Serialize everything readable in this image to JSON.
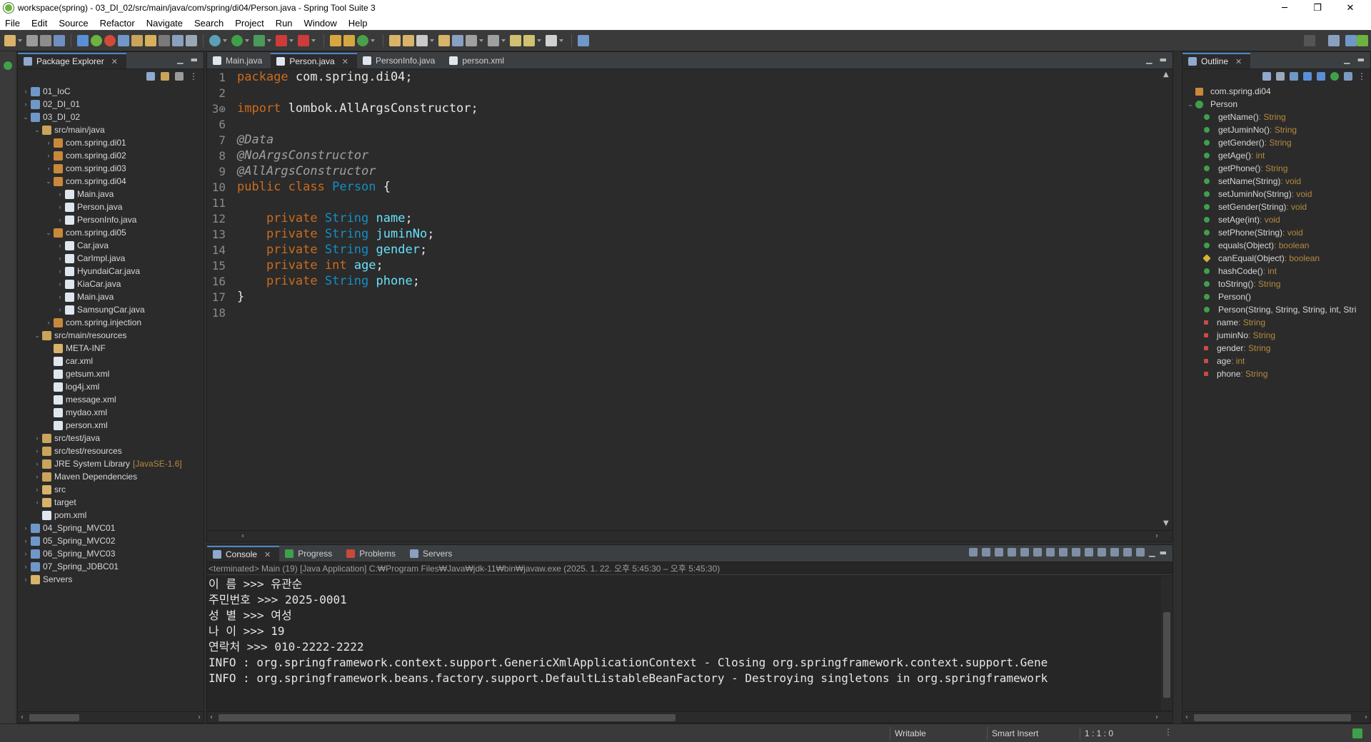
{
  "window": {
    "title": "workspace(spring) - 03_DI_02/src/main/java/com/spring/di04/Person.java - Spring Tool Suite 3",
    "minimize": "─",
    "maximize": "❐",
    "close": "✕"
  },
  "menu": [
    "File",
    "Edit",
    "Source",
    "Refactor",
    "Navigate",
    "Search",
    "Project",
    "Run",
    "Window",
    "Help"
  ],
  "package_explorer": {
    "title": "Package Explorer",
    "close": "✕",
    "tree": [
      {
        "label": "01_IoC",
        "depth": 0,
        "arrow": "›",
        "icon": "project"
      },
      {
        "label": "02_DI_01",
        "depth": 0,
        "arrow": "›",
        "icon": "project"
      },
      {
        "label": "03_DI_02",
        "depth": 0,
        "arrow": "⌄",
        "icon": "project"
      },
      {
        "label": "src/main/java",
        "depth": 1,
        "arrow": "⌄",
        "icon": "srcfolder"
      },
      {
        "label": "com.spring.di01",
        "depth": 2,
        "arrow": "›",
        "icon": "package"
      },
      {
        "label": "com.spring.di02",
        "depth": 2,
        "arrow": "›",
        "icon": "package"
      },
      {
        "label": "com.spring.di03",
        "depth": 2,
        "arrow": "›",
        "icon": "package"
      },
      {
        "label": "com.spring.di04",
        "depth": 2,
        "arrow": "⌄",
        "icon": "package"
      },
      {
        "label": "Main.java",
        "depth": 3,
        "arrow": "›",
        "icon": "java"
      },
      {
        "label": "Person.java",
        "depth": 3,
        "arrow": "›",
        "icon": "java"
      },
      {
        "label": "PersonInfo.java",
        "depth": 3,
        "arrow": "›",
        "icon": "java"
      },
      {
        "label": "com.spring.di05",
        "depth": 2,
        "arrow": "⌄",
        "icon": "package"
      },
      {
        "label": "Car.java",
        "depth": 3,
        "arrow": "›",
        "icon": "java"
      },
      {
        "label": "CarImpl.java",
        "depth": 3,
        "arrow": "›",
        "icon": "java"
      },
      {
        "label": "HyundaiCar.java",
        "depth": 3,
        "arrow": "›",
        "icon": "java"
      },
      {
        "label": "KiaCar.java",
        "depth": 3,
        "arrow": "›",
        "icon": "java"
      },
      {
        "label": "Main.java",
        "depth": 3,
        "arrow": "›",
        "icon": "java"
      },
      {
        "label": "SamsungCar.java",
        "depth": 3,
        "arrow": "›",
        "icon": "java"
      },
      {
        "label": "com.spring.injection",
        "depth": 2,
        "arrow": "›",
        "icon": "package"
      },
      {
        "label": "src/main/resources",
        "depth": 1,
        "arrow": "⌄",
        "icon": "srcfolder"
      },
      {
        "label": "META-INF",
        "depth": 2,
        "arrow": "",
        "icon": "folder"
      },
      {
        "label": "car.xml",
        "depth": 2,
        "arrow": "",
        "icon": "xml"
      },
      {
        "label": "getsum.xml",
        "depth": 2,
        "arrow": "",
        "icon": "xml"
      },
      {
        "label": "log4j.xml",
        "depth": 2,
        "arrow": "",
        "icon": "xml"
      },
      {
        "label": "message.xml",
        "depth": 2,
        "arrow": "",
        "icon": "xml"
      },
      {
        "label": "mydao.xml",
        "depth": 2,
        "arrow": "",
        "icon": "xml"
      },
      {
        "label": "person.xml",
        "depth": 2,
        "arrow": "",
        "icon": "xml"
      },
      {
        "label": "src/test/java",
        "depth": 1,
        "arrow": "›",
        "icon": "srcfolder"
      },
      {
        "label": "src/test/resources",
        "depth": 1,
        "arrow": "›",
        "icon": "srcfolder"
      },
      {
        "label": "JRE System Library",
        "deco": "[JavaSE-1.6]",
        "depth": 1,
        "arrow": "›",
        "icon": "library"
      },
      {
        "label": "Maven Dependencies",
        "depth": 1,
        "arrow": "›",
        "icon": "library"
      },
      {
        "label": "src",
        "depth": 1,
        "arrow": "›",
        "icon": "folder"
      },
      {
        "label": "target",
        "depth": 1,
        "arrow": "›",
        "icon": "folder"
      },
      {
        "label": "pom.xml",
        "depth": 1,
        "arrow": "",
        "icon": "xml"
      },
      {
        "label": "04_Spring_MVC01",
        "depth": 0,
        "arrow": "›",
        "icon": "project"
      },
      {
        "label": "05_Spring_MVC02",
        "depth": 0,
        "arrow": "›",
        "icon": "project"
      },
      {
        "label": "06_Spring_MVC03",
        "depth": 0,
        "arrow": "›",
        "icon": "project"
      },
      {
        "label": "07_Spring_JDBC01",
        "depth": 0,
        "arrow": "›",
        "icon": "project"
      },
      {
        "label": "Servers",
        "depth": 0,
        "arrow": "›",
        "icon": "folder"
      }
    ]
  },
  "editor": {
    "tabs": [
      {
        "label": "Main.java",
        "active": false
      },
      {
        "label": "Person.java",
        "active": true
      },
      {
        "label": "PersonInfo.java",
        "active": false
      },
      {
        "label": "person.xml",
        "active": false
      }
    ],
    "lines": [
      {
        "no": "1",
        "tokens": [
          [
            "kw",
            "package"
          ],
          [
            "pkgtxt",
            " com.spring.di04;"
          ]
        ]
      },
      {
        "no": "2",
        "tokens": []
      },
      {
        "no": "3⊕",
        "tokens": [
          [
            "kw",
            "import"
          ],
          [
            "pkgtxt",
            " lombok.AllArgsConstructor;"
          ]
        ]
      },
      {
        "no": "6",
        "tokens": []
      },
      {
        "no": "7",
        "tokens": [
          [
            "ann",
            "@Data"
          ]
        ]
      },
      {
        "no": "8",
        "tokens": [
          [
            "ann",
            "@NoArgsConstructor"
          ]
        ]
      },
      {
        "no": "9",
        "tokens": [
          [
            "ann",
            "@AllArgsConstructor"
          ]
        ]
      },
      {
        "no": "10",
        "tokens": [
          [
            "kw",
            "public"
          ],
          [
            "pkgtxt",
            " "
          ],
          [
            "kw",
            "class"
          ],
          [
            "pkgtxt",
            " "
          ],
          [
            "ty",
            "Person"
          ],
          [
            "pkgtxt",
            " {"
          ]
        ]
      },
      {
        "no": "11",
        "tokens": []
      },
      {
        "no": "12",
        "tokens": [
          [
            "pkgtxt",
            "    "
          ],
          [
            "kw",
            "private"
          ],
          [
            "pkgtxt",
            " "
          ],
          [
            "ty",
            "String"
          ],
          [
            "pkgtxt",
            " "
          ],
          [
            "fld",
            "name"
          ],
          [
            "pkgtxt",
            ";"
          ]
        ]
      },
      {
        "no": "13",
        "tokens": [
          [
            "pkgtxt",
            "    "
          ],
          [
            "kw",
            "private"
          ],
          [
            "pkgtxt",
            " "
          ],
          [
            "ty",
            "String"
          ],
          [
            "pkgtxt",
            " "
          ],
          [
            "fld",
            "juminNo"
          ],
          [
            "pkgtxt",
            ";"
          ]
        ]
      },
      {
        "no": "14",
        "tokens": [
          [
            "pkgtxt",
            "    "
          ],
          [
            "kw",
            "private"
          ],
          [
            "pkgtxt",
            " "
          ],
          [
            "ty",
            "String"
          ],
          [
            "pkgtxt",
            " "
          ],
          [
            "fld",
            "gender"
          ],
          [
            "pkgtxt",
            ";"
          ]
        ]
      },
      {
        "no": "15",
        "tokens": [
          [
            "pkgtxt",
            "    "
          ],
          [
            "kw",
            "private"
          ],
          [
            "pkgtxt",
            " "
          ],
          [
            "kw",
            "int"
          ],
          [
            "pkgtxt",
            " "
          ],
          [
            "fld",
            "age"
          ],
          [
            "pkgtxt",
            ";"
          ]
        ]
      },
      {
        "no": "16",
        "tokens": [
          [
            "pkgtxt",
            "    "
          ],
          [
            "kw",
            "private"
          ],
          [
            "pkgtxt",
            " "
          ],
          [
            "ty",
            "String"
          ],
          [
            "pkgtxt",
            " "
          ],
          [
            "fld",
            "phone"
          ],
          [
            "pkgtxt",
            ";"
          ]
        ]
      },
      {
        "no": "17",
        "tokens": [
          [
            "pkgtxt",
            "}"
          ]
        ]
      },
      {
        "no": "18",
        "tokens": []
      }
    ]
  },
  "console": {
    "tabs": [
      "Console",
      "Progress",
      "Problems",
      "Servers"
    ],
    "header": "<terminated> Main (19) [Java Application] C:₩Program Files₩Java₩jdk-11₩bin₩javaw.exe  (2025. 1. 22. 오후 5:45:30 – 오후 5:45:30)",
    "lines": [
      "이 름 >>> 유관순",
      "주민번호 >>> 2025-0001",
      "성 별 >>> 여성",
      "나 이 >>> 19",
      "연락처 >>> 010-2222-2222",
      "INFO : org.springframework.context.support.GenericXmlApplicationContext - Closing org.springframework.context.support.Gene",
      "INFO : org.springframework.beans.factory.support.DefaultListableBeanFactory - Destroying singletons in org.springframework"
    ]
  },
  "outline": {
    "title": "Outline",
    "close": "✕",
    "items": [
      {
        "label": "com.spring.di04",
        "type": "",
        "depth": 0,
        "arrow": "",
        "icon": "package"
      },
      {
        "label": "Person",
        "type": "",
        "depth": 0,
        "arrow": "⌄",
        "icon": "class"
      },
      {
        "label": "getName()",
        "type": " : String",
        "depth": 1,
        "icon": "public"
      },
      {
        "label": "getJuminNo()",
        "type": " : String",
        "depth": 1,
        "icon": "public"
      },
      {
        "label": "getGender()",
        "type": " : String",
        "depth": 1,
        "icon": "public"
      },
      {
        "label": "getAge()",
        "type": " : int",
        "depth": 1,
        "icon": "public"
      },
      {
        "label": "getPhone()",
        "type": " : String",
        "depth": 1,
        "icon": "public"
      },
      {
        "label": "setName(String)",
        "type": " : void",
        "depth": 1,
        "icon": "public"
      },
      {
        "label": "setJuminNo(String)",
        "type": " : void",
        "depth": 1,
        "icon": "public"
      },
      {
        "label": "setGender(String)",
        "type": " : void",
        "depth": 1,
        "icon": "public"
      },
      {
        "label": "setAge(int)",
        "type": " : void",
        "depth": 1,
        "icon": "public"
      },
      {
        "label": "setPhone(String)",
        "type": " : void",
        "depth": 1,
        "icon": "public"
      },
      {
        "label": "equals(Object)",
        "type": " : boolean",
        "depth": 1,
        "icon": "public"
      },
      {
        "label": "canEqual(Object)",
        "type": " : boolean",
        "depth": 1,
        "icon": "protected"
      },
      {
        "label": "hashCode()",
        "type": " : int",
        "depth": 1,
        "icon": "public"
      },
      {
        "label": "toString()",
        "type": " : String",
        "depth": 1,
        "icon": "public"
      },
      {
        "label": "Person()",
        "type": "",
        "depth": 1,
        "icon": "public"
      },
      {
        "label": "Person(String, String, String, int, Stri",
        "type": "",
        "depth": 1,
        "icon": "public"
      },
      {
        "label": "name",
        "type": " : String",
        "depth": 1,
        "icon": "private"
      },
      {
        "label": "juminNo",
        "type": " : String",
        "depth": 1,
        "icon": "private"
      },
      {
        "label": "gender",
        "type": " : String",
        "depth": 1,
        "icon": "private"
      },
      {
        "label": "age",
        "type": " : int",
        "depth": 1,
        "icon": "private"
      },
      {
        "label": "phone",
        "type": " : String",
        "depth": 1,
        "icon": "private"
      }
    ]
  },
  "status": {
    "writable": "Writable",
    "insert_mode": "Smart Insert",
    "position": "1 : 1 : 0"
  },
  "colors": {
    "keyword": "#cc6c1d",
    "type": "#1290c3",
    "field": "#66e1f8",
    "accent": "#4a88c7"
  }
}
